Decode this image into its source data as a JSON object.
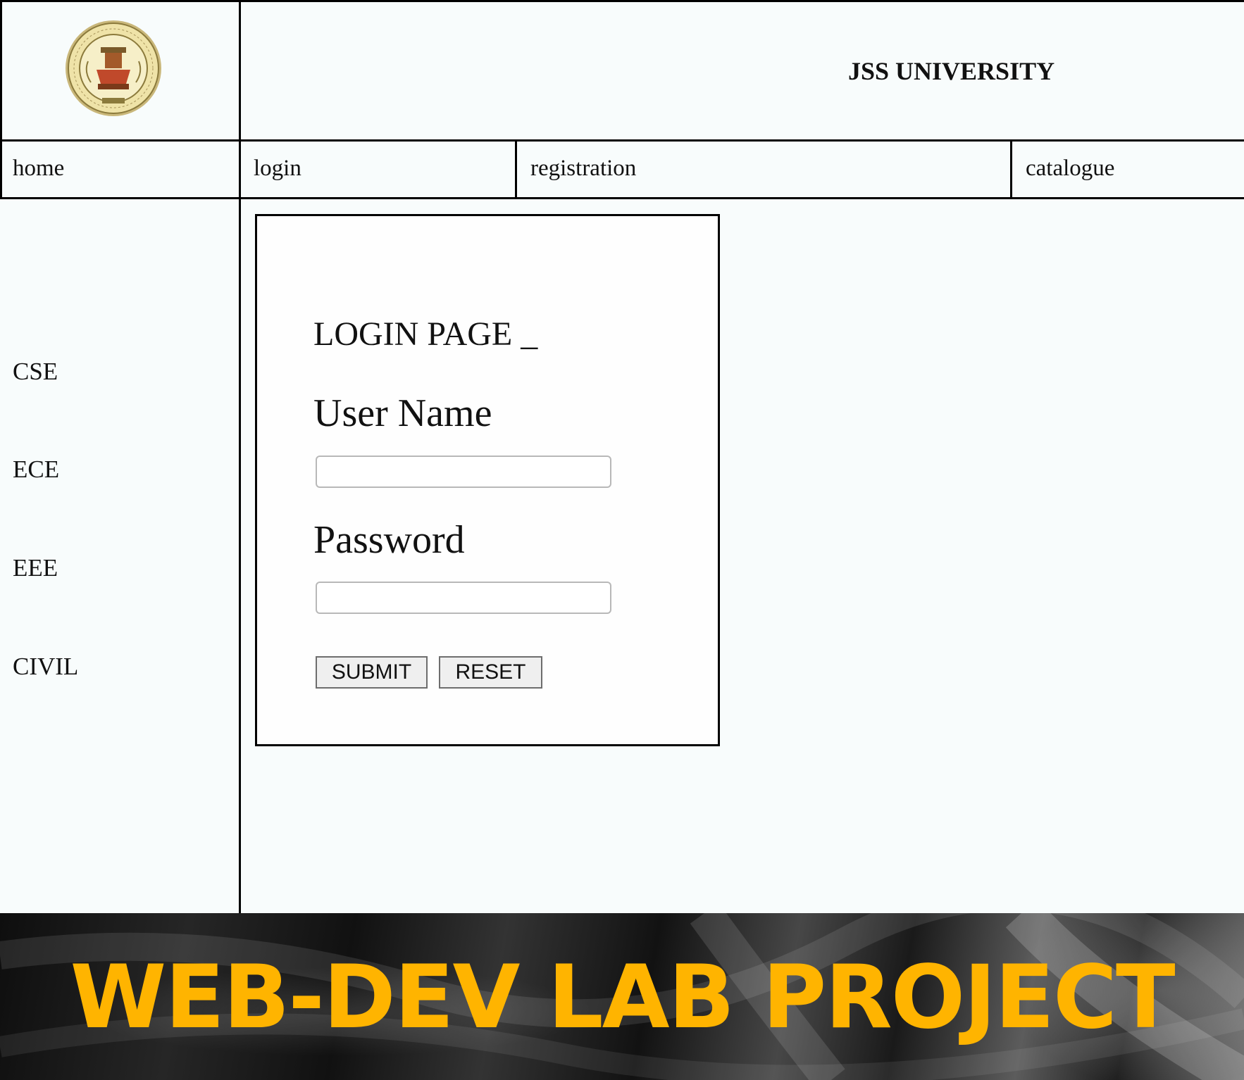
{
  "header": {
    "site_title": "JSS UNIVERSITY",
    "logo_icon": "university-seal-icon"
  },
  "nav": {
    "items": [
      {
        "label": "home"
      },
      {
        "label": "login"
      },
      {
        "label": "registration"
      },
      {
        "label": "catalogue"
      }
    ]
  },
  "sidebar": {
    "departments": [
      {
        "label": "CSE"
      },
      {
        "label": "ECE"
      },
      {
        "label": "EEE"
      },
      {
        "label": "CIVIL"
      }
    ]
  },
  "login_form": {
    "title": "LOGIN PAGE _",
    "username_label": "User Name",
    "username_value": "",
    "password_label": "Password",
    "password_value": "",
    "submit_label": "SUBMIT",
    "reset_label": "RESET"
  },
  "banner": {
    "text": "WEB-DEV LAB PROJECT",
    "accent_color": "#ffb400"
  }
}
